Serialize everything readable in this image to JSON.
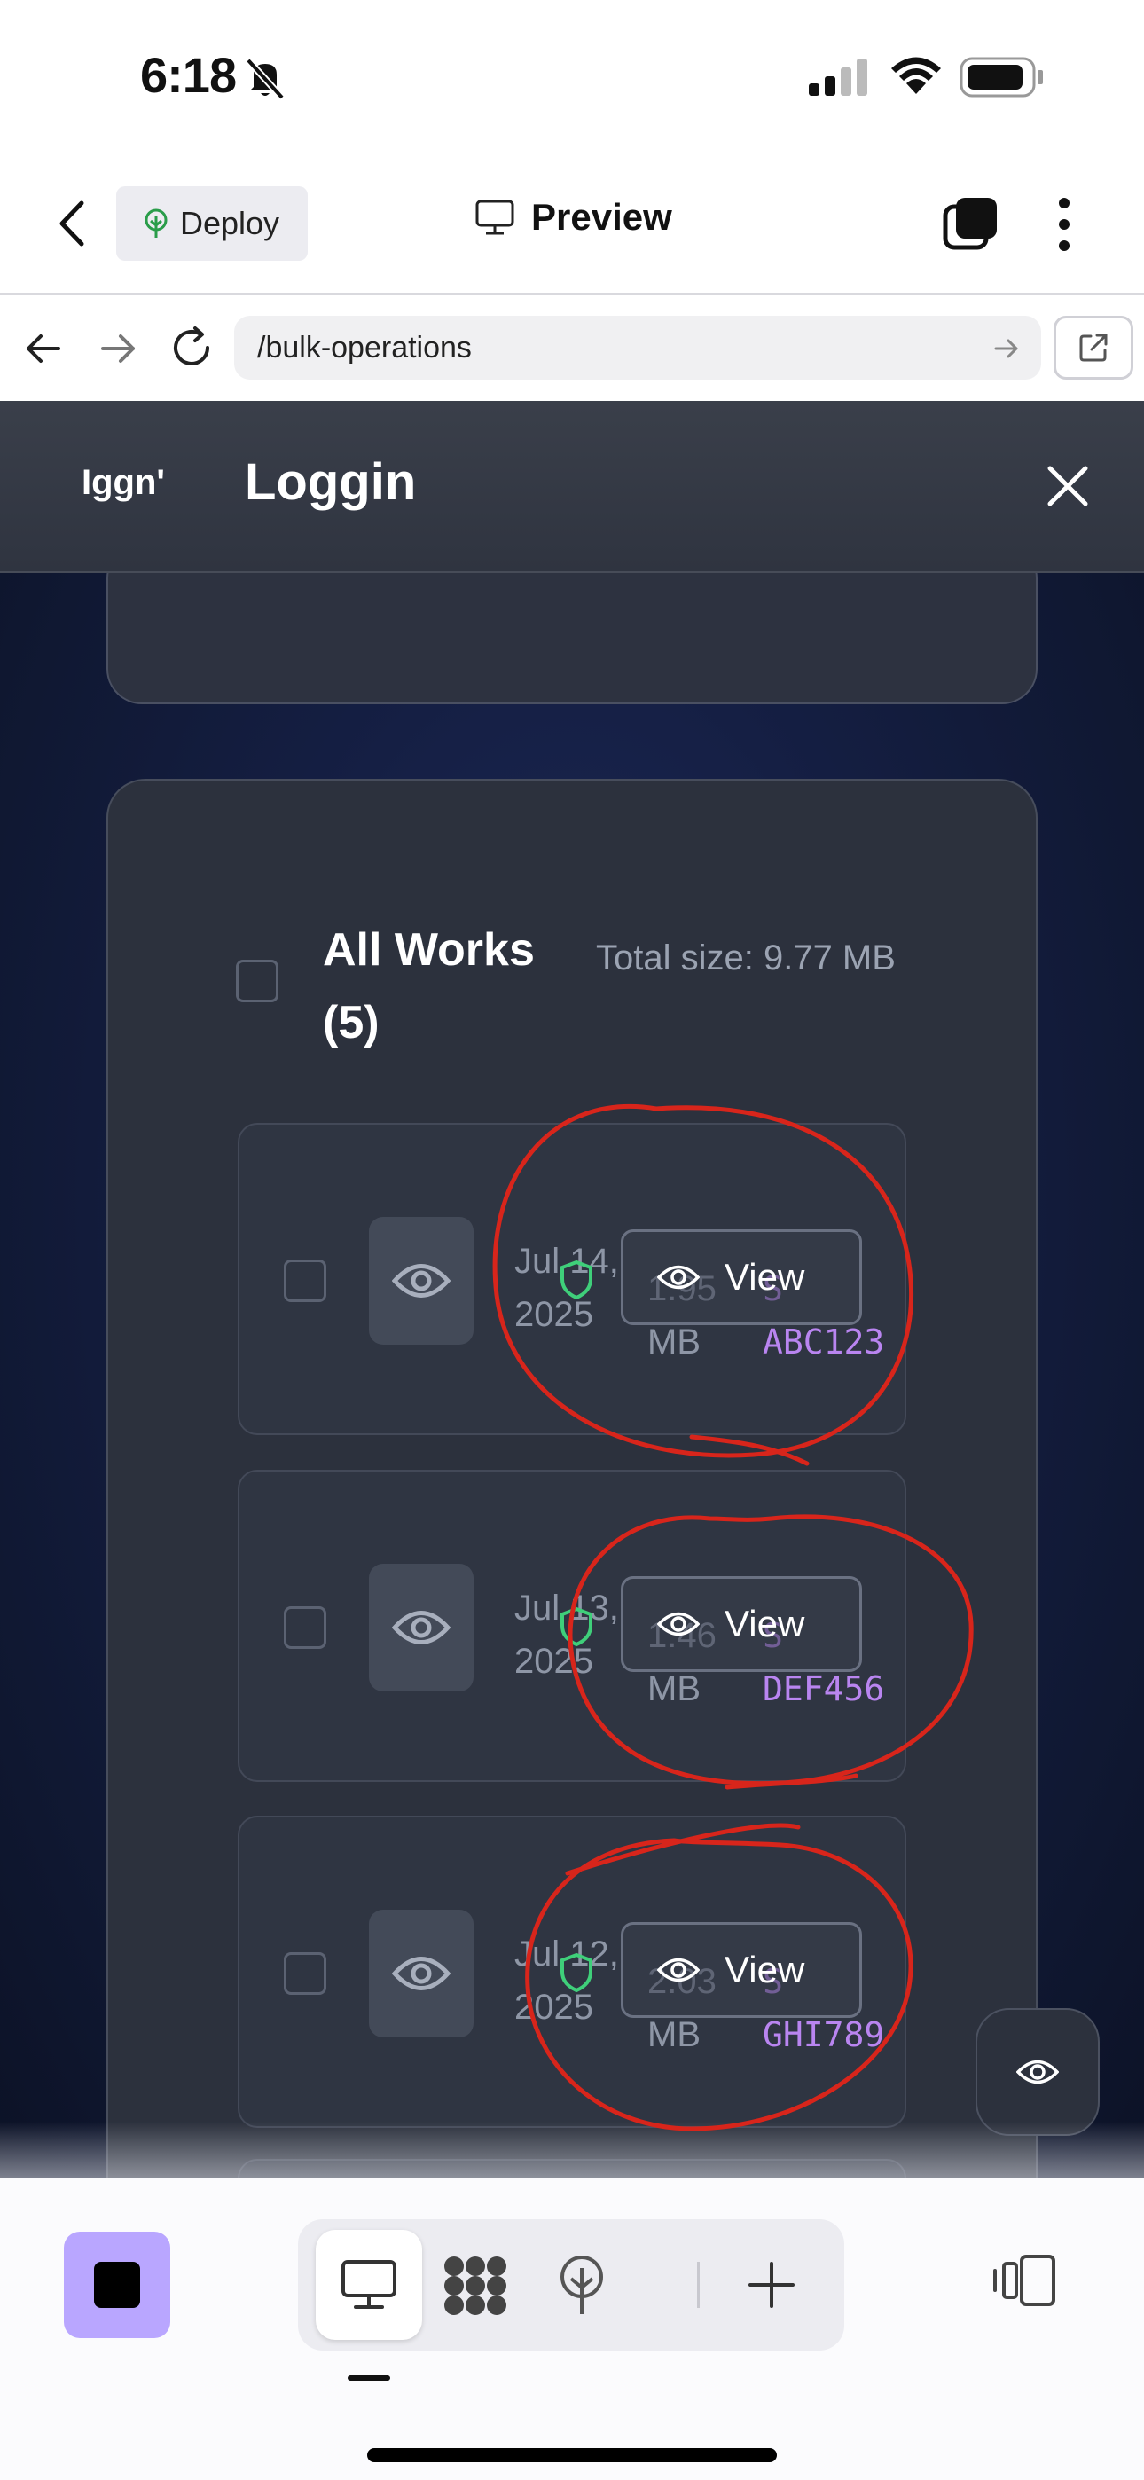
{
  "status_bar": {
    "time": "6:18"
  },
  "nav": {
    "deploy_label": "Deploy",
    "preview_label": "Preview"
  },
  "browser": {
    "url": "/bulk-operations"
  },
  "app": {
    "logo_text": "Iggn'",
    "title": "Loggin",
    "all_works_label": "All Works (5)",
    "total_size_label": "Total size: 9.77 MB",
    "view_label": "View",
    "rows": [
      {
        "date": "Jul 14, 2025",
        "size": "1.95 MB",
        "code_prefix": "S",
        "code": "ABC123"
      },
      {
        "date": "Jul 13, 2025",
        "size": "1.46 MB",
        "code_prefix": "S",
        "code": "DEF456"
      },
      {
        "date": "Jul 12, 2025",
        "size": "2.03 MB",
        "code_prefix": "S",
        "code": "GHI789"
      }
    ]
  },
  "colors": {
    "accent_purple": "#b9a6ff",
    "code_purple": "#b985f0",
    "shield_green": "#3fcf7a",
    "annotation_red": "#d8251b"
  }
}
